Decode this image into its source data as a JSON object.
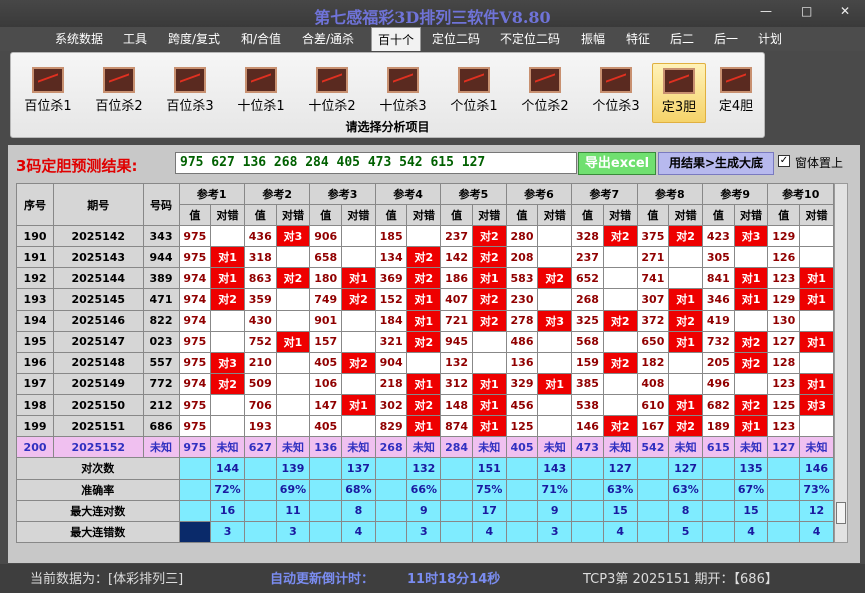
{
  "window": {
    "title": "第七感福彩3D排列三软件V8.80",
    "minimize": "—",
    "maximize": "□",
    "close": "✕"
  },
  "menu": [
    "系统数据",
    "工具",
    "跨度/复式",
    "和/合值",
    "合差/通杀",
    "百十个",
    "定位二码",
    "不定位二码",
    "振幅",
    "特征",
    "后二",
    "后一",
    "计划"
  ],
  "ribbon": {
    "buttons": [
      "百位杀1",
      "百位杀2",
      "百位杀3",
      "十位杀1",
      "十位杀2",
      "十位杀3",
      "个位杀1",
      "个位杀2",
      "个位杀3",
      "定3胆",
      "定4胆"
    ],
    "caption": "请选择分析项目"
  },
  "prediction": {
    "label": "3码定胆预测结果:",
    "value": "975 627 136 268 284 405 473 542 615 127",
    "export_label": "导出excel",
    "generate_label": "用结果>生成大底",
    "ontop_check": "✓",
    "ontop_label": "窗体置上"
  },
  "table": {
    "col_seq": "序号",
    "col_period": "期号",
    "col_code": "号码",
    "groups": [
      "参考1",
      "参考2",
      "参考3",
      "参考4",
      "参考5",
      "参考6",
      "参考7",
      "参考8",
      "参考9",
      "参考10"
    ],
    "sub_val": "值",
    "sub_res": "对错",
    "rows": [
      {
        "seq": "190",
        "period": "2025142",
        "code": "343",
        "cells": [
          [
            "975",
            ""
          ],
          [
            "436",
            "对3"
          ],
          [
            "906",
            ""
          ],
          [
            "185",
            ""
          ],
          [
            "237",
            "对2"
          ],
          [
            "280",
            ""
          ],
          [
            "328",
            "对2"
          ],
          [
            "375",
            "对2"
          ],
          [
            "423",
            "对3"
          ],
          [
            "129",
            ""
          ]
        ]
      },
      {
        "seq": "191",
        "period": "2025143",
        "code": "944",
        "cells": [
          [
            "975",
            "对1"
          ],
          [
            "318",
            ""
          ],
          [
            "658",
            ""
          ],
          [
            "134",
            "对2"
          ],
          [
            "142",
            "对2"
          ],
          [
            "208",
            ""
          ],
          [
            "237",
            ""
          ],
          [
            "271",
            ""
          ],
          [
            "305",
            ""
          ],
          [
            "126",
            ""
          ]
        ]
      },
      {
        "seq": "192",
        "period": "2025144",
        "code": "389",
        "cells": [
          [
            "974",
            "对1"
          ],
          [
            "863",
            "对2"
          ],
          [
            "180",
            "对1"
          ],
          [
            "369",
            "对2"
          ],
          [
            "186",
            "对1"
          ],
          [
            "583",
            "对2"
          ],
          [
            "652",
            ""
          ],
          [
            "741",
            ""
          ],
          [
            "841",
            "对1"
          ],
          [
            "123",
            "对1"
          ]
        ]
      },
      {
        "seq": "193",
        "period": "2025145",
        "code": "471",
        "cells": [
          [
            "974",
            "对2"
          ],
          [
            "359",
            ""
          ],
          [
            "749",
            "对2"
          ],
          [
            "152",
            "对1"
          ],
          [
            "407",
            "对2"
          ],
          [
            "230",
            ""
          ],
          [
            "268",
            ""
          ],
          [
            "307",
            "对1"
          ],
          [
            "346",
            "对1"
          ],
          [
            "129",
            "对1"
          ]
        ]
      },
      {
        "seq": "194",
        "period": "2025146",
        "code": "822",
        "cells": [
          [
            "974",
            ""
          ],
          [
            "430",
            ""
          ],
          [
            "901",
            ""
          ],
          [
            "184",
            "对1"
          ],
          [
            "721",
            "对2"
          ],
          [
            "278",
            "对3"
          ],
          [
            "325",
            "对2"
          ],
          [
            "372",
            "对2"
          ],
          [
            "419",
            ""
          ],
          [
            "130",
            ""
          ]
        ]
      },
      {
        "seq": "195",
        "period": "2025147",
        "code": "023",
        "cells": [
          [
            "975",
            ""
          ],
          [
            "752",
            "对1"
          ],
          [
            "157",
            ""
          ],
          [
            "321",
            "对2"
          ],
          [
            "945",
            ""
          ],
          [
            "486",
            ""
          ],
          [
            "568",
            ""
          ],
          [
            "650",
            "对1"
          ],
          [
            "732",
            "对2"
          ],
          [
            "127",
            "对1"
          ]
        ]
      },
      {
        "seq": "196",
        "period": "2025148",
        "code": "557",
        "cells": [
          [
            "975",
            "对3"
          ],
          [
            "210",
            ""
          ],
          [
            "405",
            "对2"
          ],
          [
            "904",
            ""
          ],
          [
            "132",
            ""
          ],
          [
            "136",
            ""
          ],
          [
            "159",
            "对2"
          ],
          [
            "182",
            ""
          ],
          [
            "205",
            "对2"
          ],
          [
            "128",
            ""
          ]
        ]
      },
      {
        "seq": "197",
        "period": "2025149",
        "code": "772",
        "cells": [
          [
            "974",
            "对2"
          ],
          [
            "509",
            ""
          ],
          [
            "106",
            ""
          ],
          [
            "218",
            "对1"
          ],
          [
            "312",
            "对1"
          ],
          [
            "329",
            "对1"
          ],
          [
            "385",
            ""
          ],
          [
            "408",
            ""
          ],
          [
            "496",
            ""
          ],
          [
            "123",
            "对1"
          ]
        ]
      },
      {
        "seq": "198",
        "period": "2025150",
        "code": "212",
        "cells": [
          [
            "975",
            ""
          ],
          [
            "706",
            ""
          ],
          [
            "147",
            "对1"
          ],
          [
            "302",
            "对2"
          ],
          [
            "148",
            "对1"
          ],
          [
            "456",
            ""
          ],
          [
            "538",
            ""
          ],
          [
            "610",
            "对1"
          ],
          [
            "682",
            "对2"
          ],
          [
            "125",
            "对3"
          ]
        ]
      },
      {
        "seq": "199",
        "period": "2025151",
        "code": "686",
        "cells": [
          [
            "975",
            ""
          ],
          [
            "193",
            ""
          ],
          [
            "405",
            ""
          ],
          [
            "829",
            "对1"
          ],
          [
            "874",
            "对1"
          ],
          [
            "125",
            ""
          ],
          [
            "146",
            "对2"
          ],
          [
            "167",
            "对2"
          ],
          [
            "189",
            "对1"
          ],
          [
            "123",
            ""
          ]
        ]
      },
      {
        "seq": "200",
        "period": "2025152",
        "code": "未知",
        "cells": [
          [
            "975",
            "未知"
          ],
          [
            "627",
            "未知"
          ],
          [
            "136",
            "未知"
          ],
          [
            "268",
            "未知"
          ],
          [
            "284",
            "未知"
          ],
          [
            "405",
            "未知"
          ],
          [
            "473",
            "未知"
          ],
          [
            "542",
            "未知"
          ],
          [
            "615",
            "未知"
          ],
          [
            "127",
            "未知"
          ]
        ]
      }
    ],
    "stats": [
      {
        "label": "对次数",
        "values": [
          "144",
          "139",
          "137",
          "132",
          "151",
          "143",
          "127",
          "127",
          "135",
          "146"
        ]
      },
      {
        "label": "准确率",
        "values": [
          "72%",
          "69%",
          "68%",
          "66%",
          "75%",
          "71%",
          "63%",
          "63%",
          "67%",
          "73%"
        ]
      },
      {
        "label": "最大连对数",
        "values": [
          "16",
          "11",
          "8",
          "9",
          "17",
          "9",
          "15",
          "8",
          "15",
          "12"
        ]
      },
      {
        "label": "最大连错数",
        "values": [
          "3",
          "3",
          "4",
          "3",
          "4",
          "3",
          "4",
          "5",
          "4",
          "4"
        ]
      }
    ]
  },
  "status": {
    "current": "当前数据为：[体彩排列三]",
    "countdown_label": "自动更新倒计时：",
    "countdown": "11时18分14秒",
    "draw": "TCP3第 2025151 期开：【686】"
  },
  "colors": {
    "hit": "#ee0000",
    "stats_bg": "#7fecff",
    "unknown_row": "#f0c0f0",
    "selected_tab": "#f5d36a"
  }
}
